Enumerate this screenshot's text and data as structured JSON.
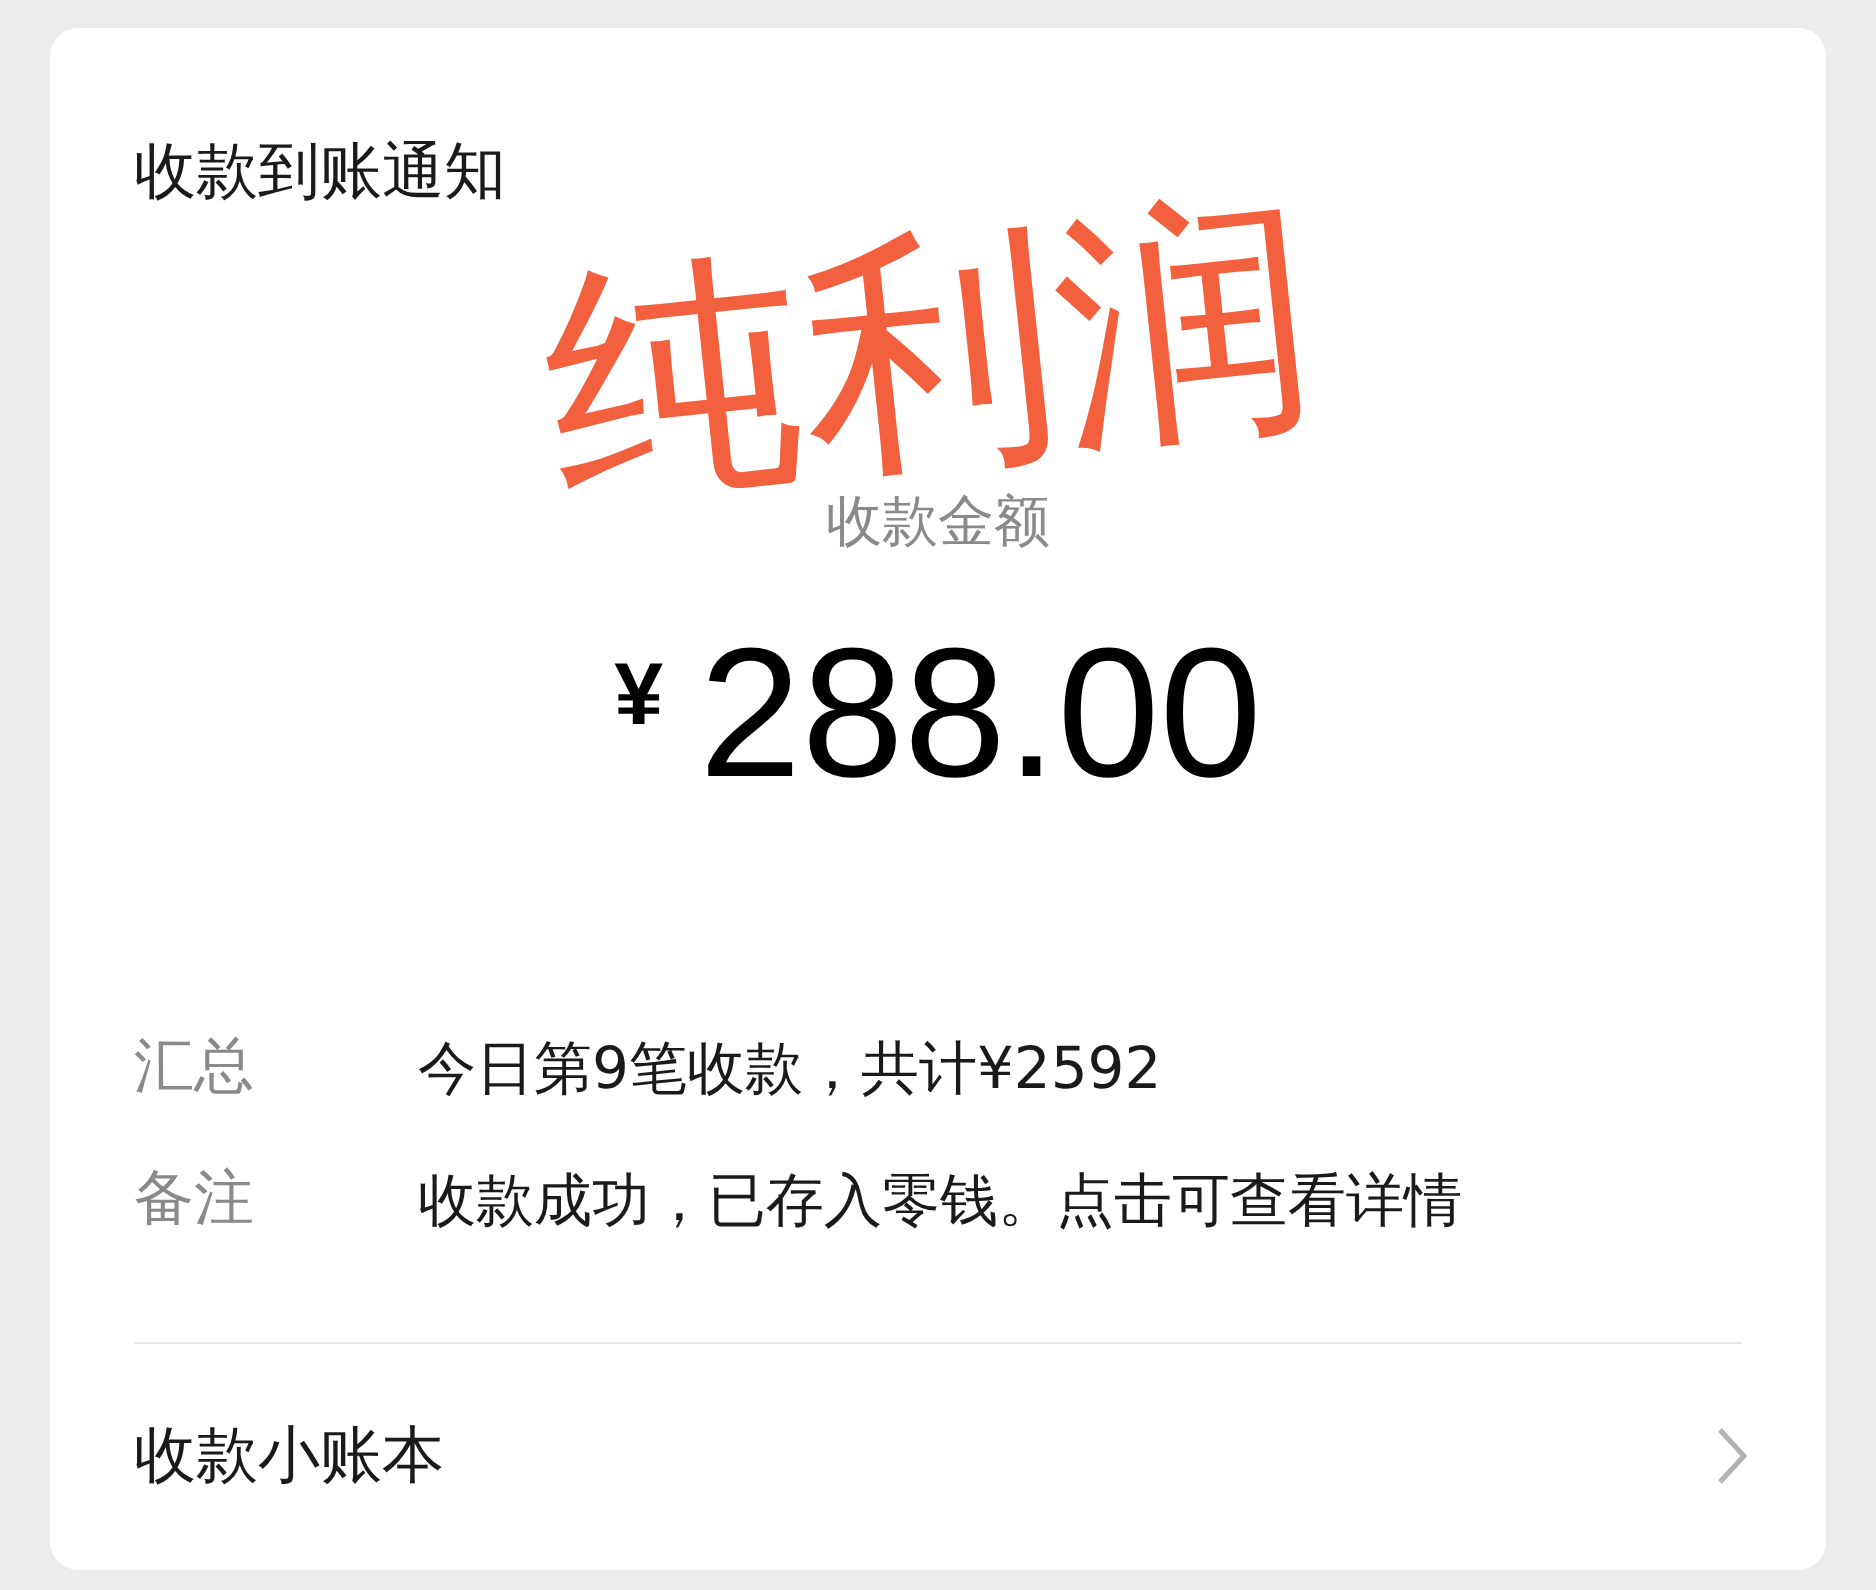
{
  "card": {
    "title": "收款到账通知",
    "overlay_text": "纯利润",
    "amount_label": "收款金额",
    "currency": "¥",
    "amount": "288.00",
    "details": [
      {
        "label": "汇总",
        "value": "今日第9笔收款，共计¥2592"
      },
      {
        "label": "备注",
        "value": "收款成功，已存入零钱。点击可查看详情"
      }
    ],
    "footer": {
      "label": "收款小账本"
    }
  }
}
